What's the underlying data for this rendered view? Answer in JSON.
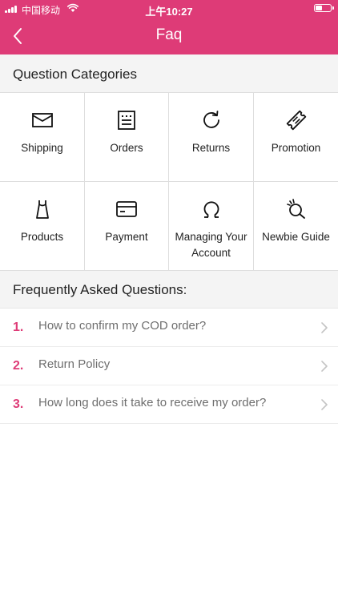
{
  "status_bar": {
    "carrier": "中国移动",
    "time": "上午10:27",
    "battery_level": 0.45
  },
  "nav": {
    "title": "Faq",
    "back_icon": "chevron-left-icon"
  },
  "categories": {
    "heading": "Question Categories",
    "items": [
      {
        "label": "Shipping",
        "icon": "envelope-icon"
      },
      {
        "label": "Orders",
        "icon": "order-list-icon"
      },
      {
        "label": "Returns",
        "icon": "refresh-icon"
      },
      {
        "label": "Promotion",
        "icon": "ticket-icon"
      },
      {
        "label": "Products",
        "icon": "dress-icon"
      },
      {
        "label": "Payment",
        "icon": "credit-card-icon"
      },
      {
        "label": "Managing Your Account",
        "icon": "omega-account-icon"
      },
      {
        "label": "Newbie Guide",
        "icon": "newbie-guide-icon"
      }
    ]
  },
  "faq": {
    "heading": "Frequently Asked Questions:",
    "items": [
      {
        "number": "1.",
        "question": "How to confirm my COD order?"
      },
      {
        "number": "2.",
        "question": "Return Policy"
      },
      {
        "number": "3.",
        "question": "How long does it take to receive my order?"
      }
    ]
  },
  "colors": {
    "accent": "#de3b77",
    "section_bg": "#f4f4f4",
    "divider": "#dedede",
    "question_text": "#6e6e6e"
  }
}
